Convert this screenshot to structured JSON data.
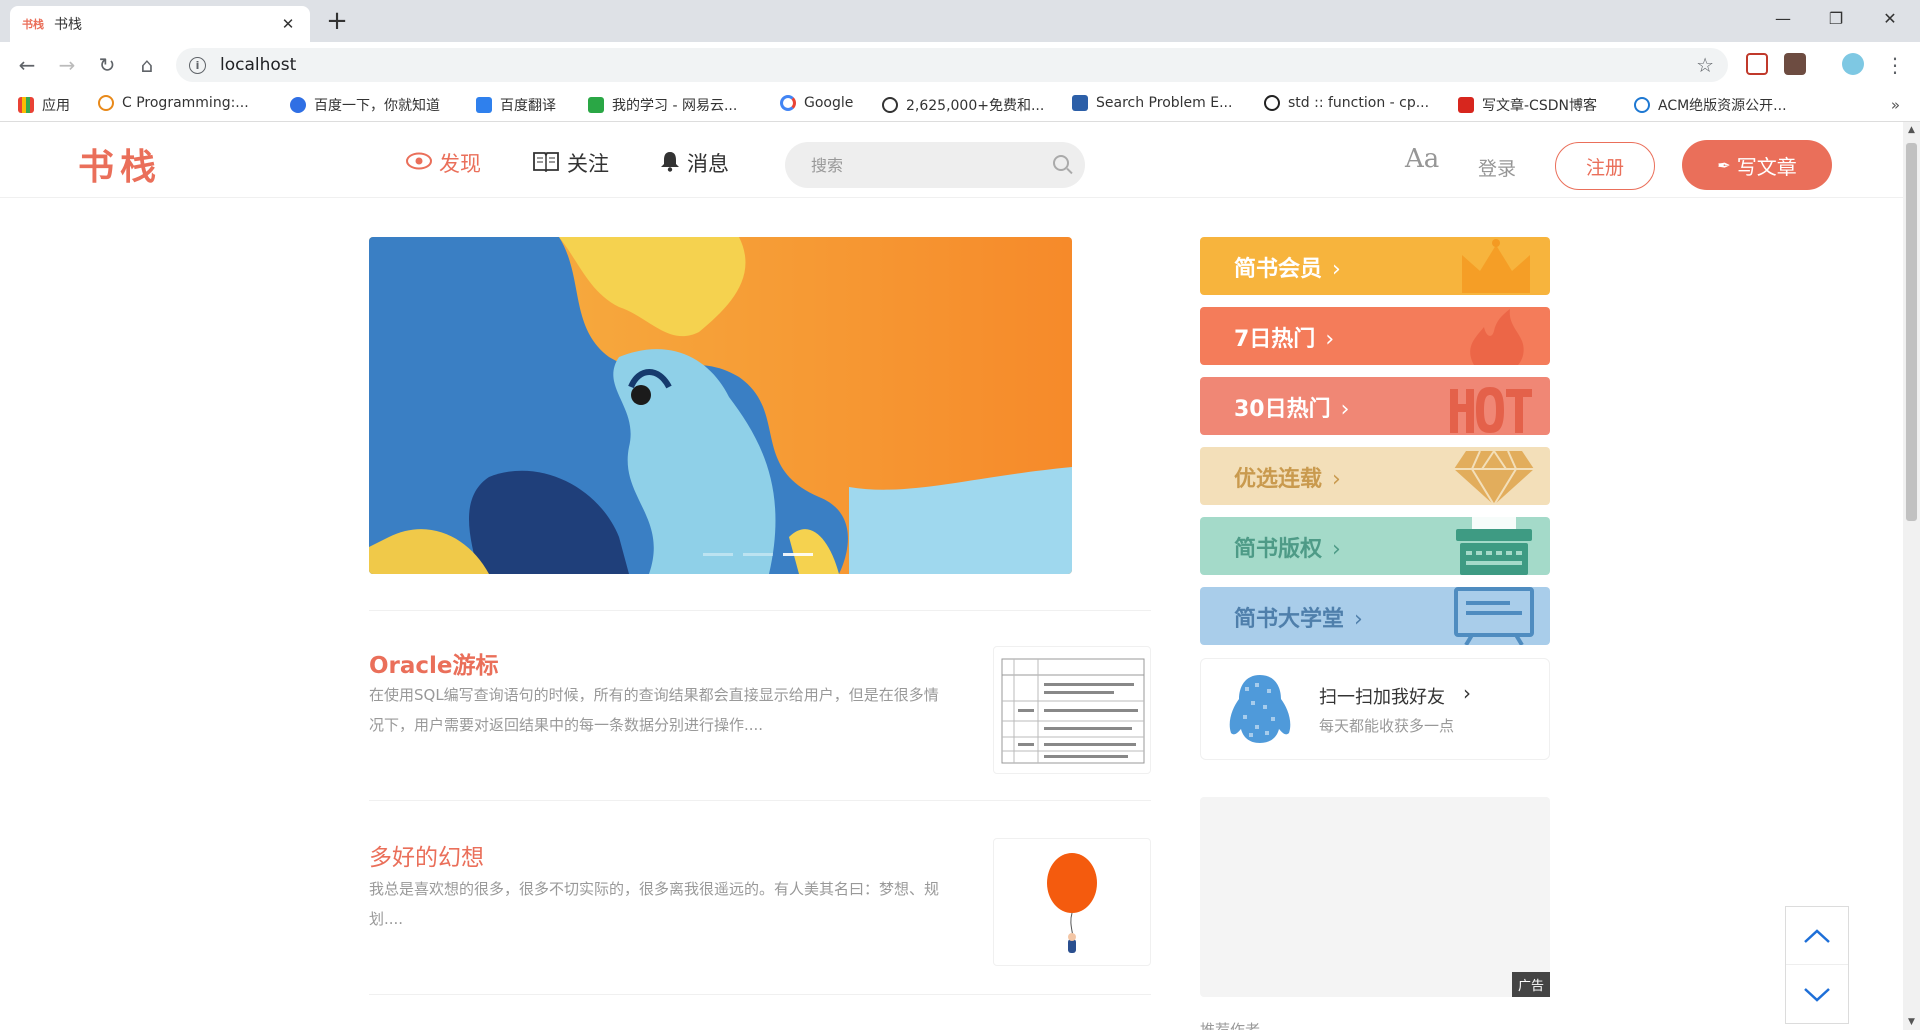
{
  "browser": {
    "tab_title": "书栈",
    "tab_favicon": "书栈",
    "url": "localhost",
    "bookmarks": [
      {
        "label": "应用",
        "icon": "apps-grid-icon"
      },
      {
        "label": "C Programming:...",
        "icon": "c-programming-icon"
      },
      {
        "label": "百度一下，你就知道",
        "icon": "baidu-paw-icon"
      },
      {
        "label": "百度翻译",
        "icon": "baidu-translate-icon"
      },
      {
        "label": "我的学习 - 网易云...",
        "icon": "netease-study-icon"
      },
      {
        "label": "Google",
        "icon": "google-icon"
      },
      {
        "label": "2,625,000+免费和...",
        "icon": "download-icon"
      },
      {
        "label": "Search Problem E...",
        "icon": "poj-icon"
      },
      {
        "label": "std :: function - cp...",
        "icon": "cppreference-icon"
      },
      {
        "label": "写文章-CSDN博客",
        "icon": "csdn-icon"
      },
      {
        "label": "ACM绝版资源公开...",
        "icon": "acm-icon"
      }
    ],
    "more": "»"
  },
  "header": {
    "logo": "书栈",
    "nav": [
      {
        "label": "发现",
        "icon": "eye-icon",
        "active": true
      },
      {
        "label": "关注",
        "icon": "book-icon",
        "active": false
      },
      {
        "label": "消息",
        "icon": "bell-icon",
        "active": false
      }
    ],
    "search_placeholder": "搜索",
    "font_toggle": "Aa",
    "login": "登录",
    "register": "注册",
    "write": "写文章",
    "accent": "#ea6f5a"
  },
  "banner": {
    "slides": 3,
    "active_slide": 2
  },
  "articles": [
    {
      "title": "Oracle游标",
      "abstract": "在使用SQL编写查询语句的时候，所有的查询结果都会直接显示给用户，但是在很多情况下，用户需要对返回结果中的每一条数据分别进行操作...."
    },
    {
      "title": "多好的幻想",
      "abstract": "我总是喜欢想的很多，很多不切实际的，很多离我很遥远的。有人美其名曰：梦想、规划...."
    }
  ],
  "sidebar": {
    "boards": [
      {
        "label": "简书会员",
        "color": "#f7b43d",
        "icon": "crown-icon"
      },
      {
        "label": "7日热门",
        "color": "#f47c5a",
        "icon": "flame-icon"
      },
      {
        "label": "30日热门",
        "color": "#f08775",
        "icon": "hot-icon"
      },
      {
        "label": "优选连载",
        "color": "#f3dfb9",
        "icon": "diamond-icon"
      },
      {
        "label": "简书版权",
        "color": "#a4dac9",
        "icon": "typewriter-icon"
      },
      {
        "label": "简书大学堂",
        "color": "#a9cdea",
        "icon": "blackboard-icon"
      }
    ],
    "board_label_colors": [
      "#ffffff",
      "#ffffff",
      "#ffffff",
      "#c99a4e",
      "#4e9b87",
      "#4f7fab"
    ],
    "arrow": "›",
    "qr": {
      "title": "扫一扫加我好友",
      "subtitle": "每天都能收获多一点"
    },
    "ad_tag": "广告",
    "next_section": "推荐作者"
  }
}
